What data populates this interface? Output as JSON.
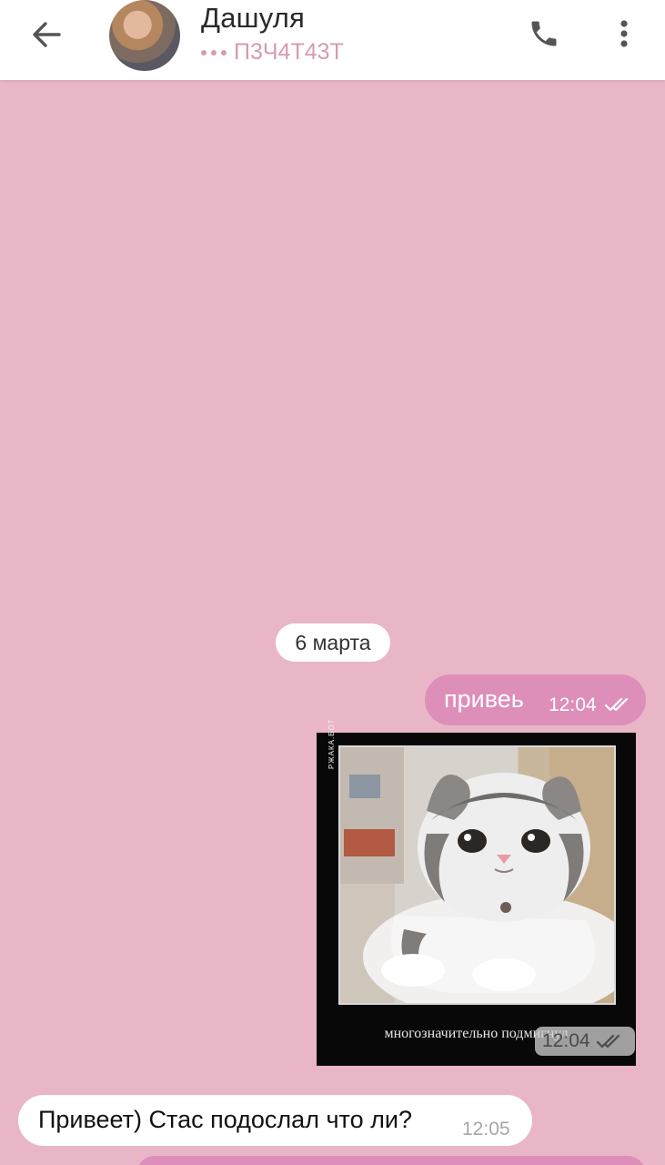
{
  "header": {
    "contact_name": "Дашуля",
    "status": "П3Ч4Т43Т",
    "colors": {
      "status": "#d79ab4",
      "background": "#ffffff"
    },
    "icons": [
      "back-arrow-icon",
      "avatar",
      "phone-icon",
      "more-vertical-icon"
    ]
  },
  "chat": {
    "background_color": "#e9b6c8",
    "date_label": "6 марта",
    "messages": [
      {
        "direction": "out",
        "type": "text",
        "text": "привеь",
        "time": "12:04",
        "status": "read"
      },
      {
        "direction": "out",
        "type": "photo",
        "caption": "многозначительно подмигнул",
        "watermark": "РЖАКА.БОТ",
        "time": "12:04",
        "status": "read"
      },
      {
        "direction": "in",
        "type": "text",
        "text": "Привеет) Стас подослал что ли?",
        "time": "12:05"
      }
    ],
    "colors": {
      "outgoing": "#dd8fb9",
      "incoming": "#ffffff"
    }
  }
}
